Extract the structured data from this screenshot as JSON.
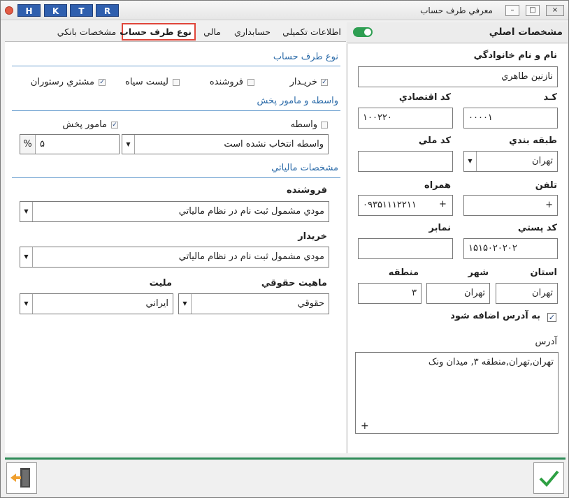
{
  "window": {
    "title": "معرفي طرف حساب",
    "quick_buttons": [
      "H",
      "K",
      "T",
      "R"
    ],
    "controls": [
      "–",
      "□",
      "×"
    ]
  },
  "tabs": [
    {
      "label": "اطلاعات تكميلي"
    },
    {
      "label": "حسابداري"
    },
    {
      "label": "مالي"
    },
    {
      "label": "نوع طرف حساب"
    },
    {
      "label": "مشخصات بانكي"
    }
  ],
  "main": {
    "header": "مشخصات اصلي",
    "name_label": "نام و نام خانوادگي",
    "name_value": "نازنين طاهري",
    "code_label": "كـد",
    "code_value": "۰۰۰۰۱",
    "econ_code_label": "كد اقتصادي",
    "econ_code_value": "۱۰۰۲۲۰",
    "category_label": "طبقه بندي",
    "category_value": "تهران",
    "national_code_label": "كد ملي",
    "national_code_value": "",
    "phone_label": "تلفن",
    "phone_value": "+",
    "mobile_label": "همراه",
    "mobile_value": "۰۹۳۵۱۱۱۲۲۱۱",
    "mobile_prefix": "+",
    "postal_label": "كد پستي",
    "postal_value": "۱۵۱۵۰۲۰۲۰۲",
    "fax_label": "نمابر",
    "fax_value": "",
    "province_label": "استان",
    "province_value": "تهران",
    "city_label": "شهر",
    "city_value": "تهران",
    "region_label": "منطقه",
    "region_value": "۳",
    "add_to_address_label": "به آدرس اضافه شود",
    "address_label": "آدرس",
    "address_value": "تهران,تهران,منطقه ۳, ميدان ونک",
    "address_plus": "+"
  },
  "account_type": {
    "section_title": "نوع طرف حساب",
    "buyer_label": "خريـدار",
    "buyer_checked": true,
    "seller_label": "فروشنده",
    "seller_checked": false,
    "blacklist_label": "ليست سياه",
    "blacklist_checked": false,
    "restaurant_label": "مشتري رستوران",
    "restaurant_checked": true
  },
  "agent": {
    "section_title": "واسطه و مامور پخش",
    "broker_label": "واسطه",
    "broker_checked": false,
    "distributor_label": "مامور پخش",
    "distributor_checked": true,
    "broker_select": "واسطه انتخاب نشده است",
    "percent_value": "۵",
    "percent_sign": "%"
  },
  "tax": {
    "section_title": "مشخصات مالياتي",
    "seller_label": "فروشنده",
    "seller_value": "مودي مشمول ثبت نام در نظام مالياتي",
    "buyer_label": "خريدار",
    "buyer_value": "مودي مشمول ثبت نام در نظام مالياتي",
    "legal_label": "ماهيت حقوقي",
    "legal_value": "حقوقي",
    "nationality_label": "مليت",
    "nationality_value": "ايراني"
  },
  "colors": {
    "accent": "#2a6aa8",
    "toggle": "#2e9e52",
    "tab_highlight": "#e0463a",
    "confirm": "#2ea043",
    "exit": "#f0a030"
  },
  "icons": {
    "exit": "exit-door-icon",
    "confirm": "checkmark-icon"
  }
}
